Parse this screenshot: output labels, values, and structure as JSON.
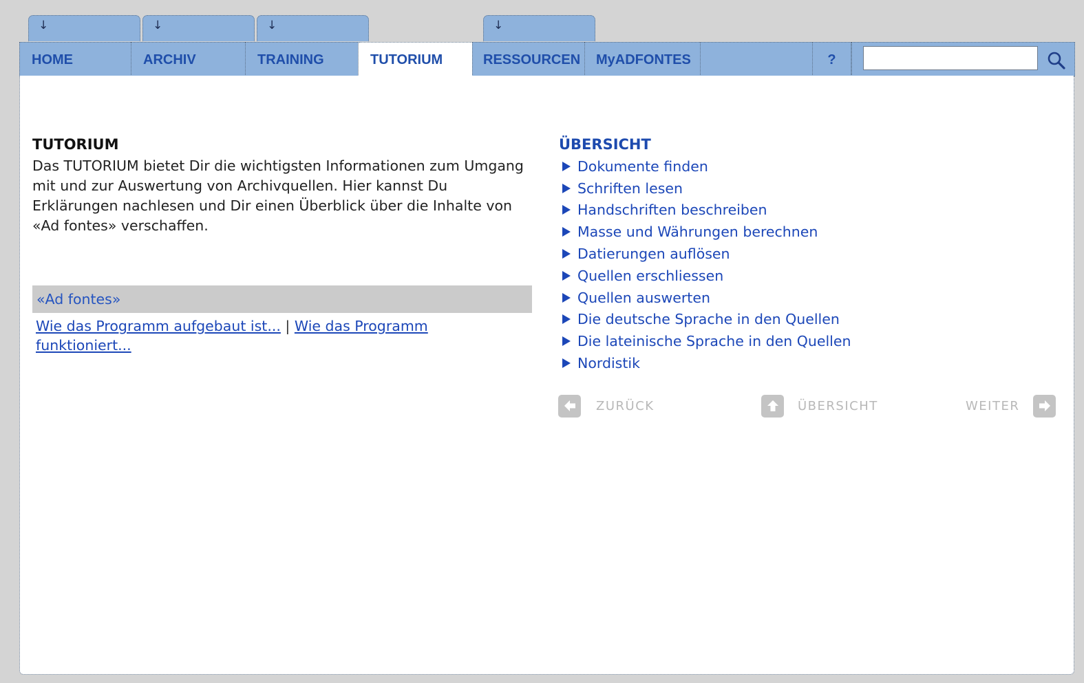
{
  "dropdown_tabs": [
    {
      "icon": "arrow-down-icon",
      "glyph": "↓"
    },
    {
      "icon": "arrow-down-icon",
      "glyph": "↓"
    },
    {
      "icon": "arrow-down-icon",
      "glyph": "↓"
    },
    {
      "icon": "arrow-down-icon",
      "glyph": "↓"
    }
  ],
  "nav": {
    "home": "HOME",
    "archiv": "ARCHIV",
    "training": "TRAINING",
    "tutorium": "TUTORIUM",
    "ressourcen": "RESSOURCEN",
    "myadfontes": "MyADFONTES",
    "help": "?",
    "active": "TUTORIUM"
  },
  "search": {
    "value": "",
    "placeholder": "",
    "icon": "search-icon"
  },
  "intro": {
    "title": "TUTORIUM",
    "text": "Das TUTORIUM bietet Dir die wichtigsten Informationen zum Umgang mit und zur Auswertung von Archivquellen. Hier kannst Du Erklärungen nachlesen und Dir einen Überblick über die Inhalte von «Ad fontes» verschaffen."
  },
  "adfontes": {
    "header": "«Ad fontes»",
    "link1": "Wie das Programm aufgebaut ist...",
    "separator": "|",
    "link2": "Wie das Programm funktioniert..."
  },
  "overview": {
    "title": "ÜBERSICHT",
    "items": [
      "Dokumente finden",
      "Schriften lesen",
      "Handschriften beschreiben",
      "Masse und Währungen berechnen",
      "Datierungen auflösen",
      "Quellen erschliessen",
      "Quellen auswerten",
      "Die deutsche Sprache in den Quellen",
      "Die lateinische Sprache in den Quellen",
      "Nordistik"
    ]
  },
  "pager": {
    "back": "ZURÜCK",
    "overview": "ÜBERSICHT",
    "next": "WEITER"
  },
  "colors": {
    "tab_blue": "#8eb2dc",
    "link_blue": "#1c47b8",
    "bg_grey": "#d4d4d4"
  }
}
